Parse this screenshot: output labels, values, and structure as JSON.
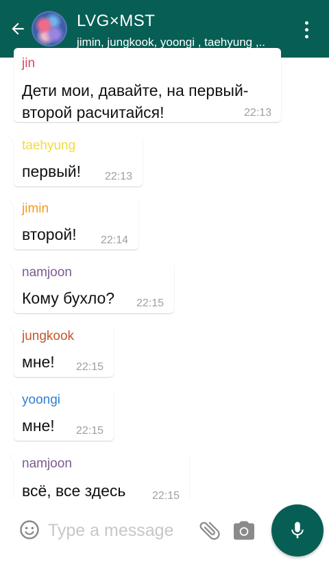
{
  "header": {
    "title": "LVG×MST",
    "subtitle": "jimin, jungkook, yoongi , taehyung ,..",
    "back_icon": "arrow-left-icon",
    "more_icon": "more-vertical-icon"
  },
  "messages": [
    {
      "sender": "jin",
      "sender_color": "#e0445e",
      "text": "Дети мои, давайте, на первый-второй расчитайся!",
      "line1": "Дети мои, давайте, на первый-",
      "line2": "второй расчитайся!",
      "time": "22:13"
    },
    {
      "sender": "taehyung",
      "sender_color": "#f2dc3a",
      "text": "первый!",
      "time": "22:13"
    },
    {
      "sender": "jimin",
      "sender_color": "#f39c18",
      "text": "второй!",
      "time": "22:14"
    },
    {
      "sender": "namjoon",
      "sender_color": "#7a5b8e",
      "text": "Кому бухло?",
      "time": "22:15"
    },
    {
      "sender": "jungkook",
      "sender_color": "#c0562e",
      "text": "мне!",
      "time": "22:15"
    },
    {
      "sender": "yoongi",
      "sender_color": "#2f7fd1",
      "text": "мне!",
      "time": "22:15"
    },
    {
      "sender": "namjoon",
      "sender_color": "#7a5b8e",
      "text": "всё, все здесь",
      "time": "22:15"
    }
  ],
  "input": {
    "placeholder": "Type a message",
    "emoji_icon": "smiley-icon",
    "attach_icon": "paperclip-icon",
    "camera_icon": "camera-icon",
    "mic_icon": "microphone-icon"
  },
  "colors": {
    "header": "#075e54",
    "mic_button": "#075e54"
  }
}
